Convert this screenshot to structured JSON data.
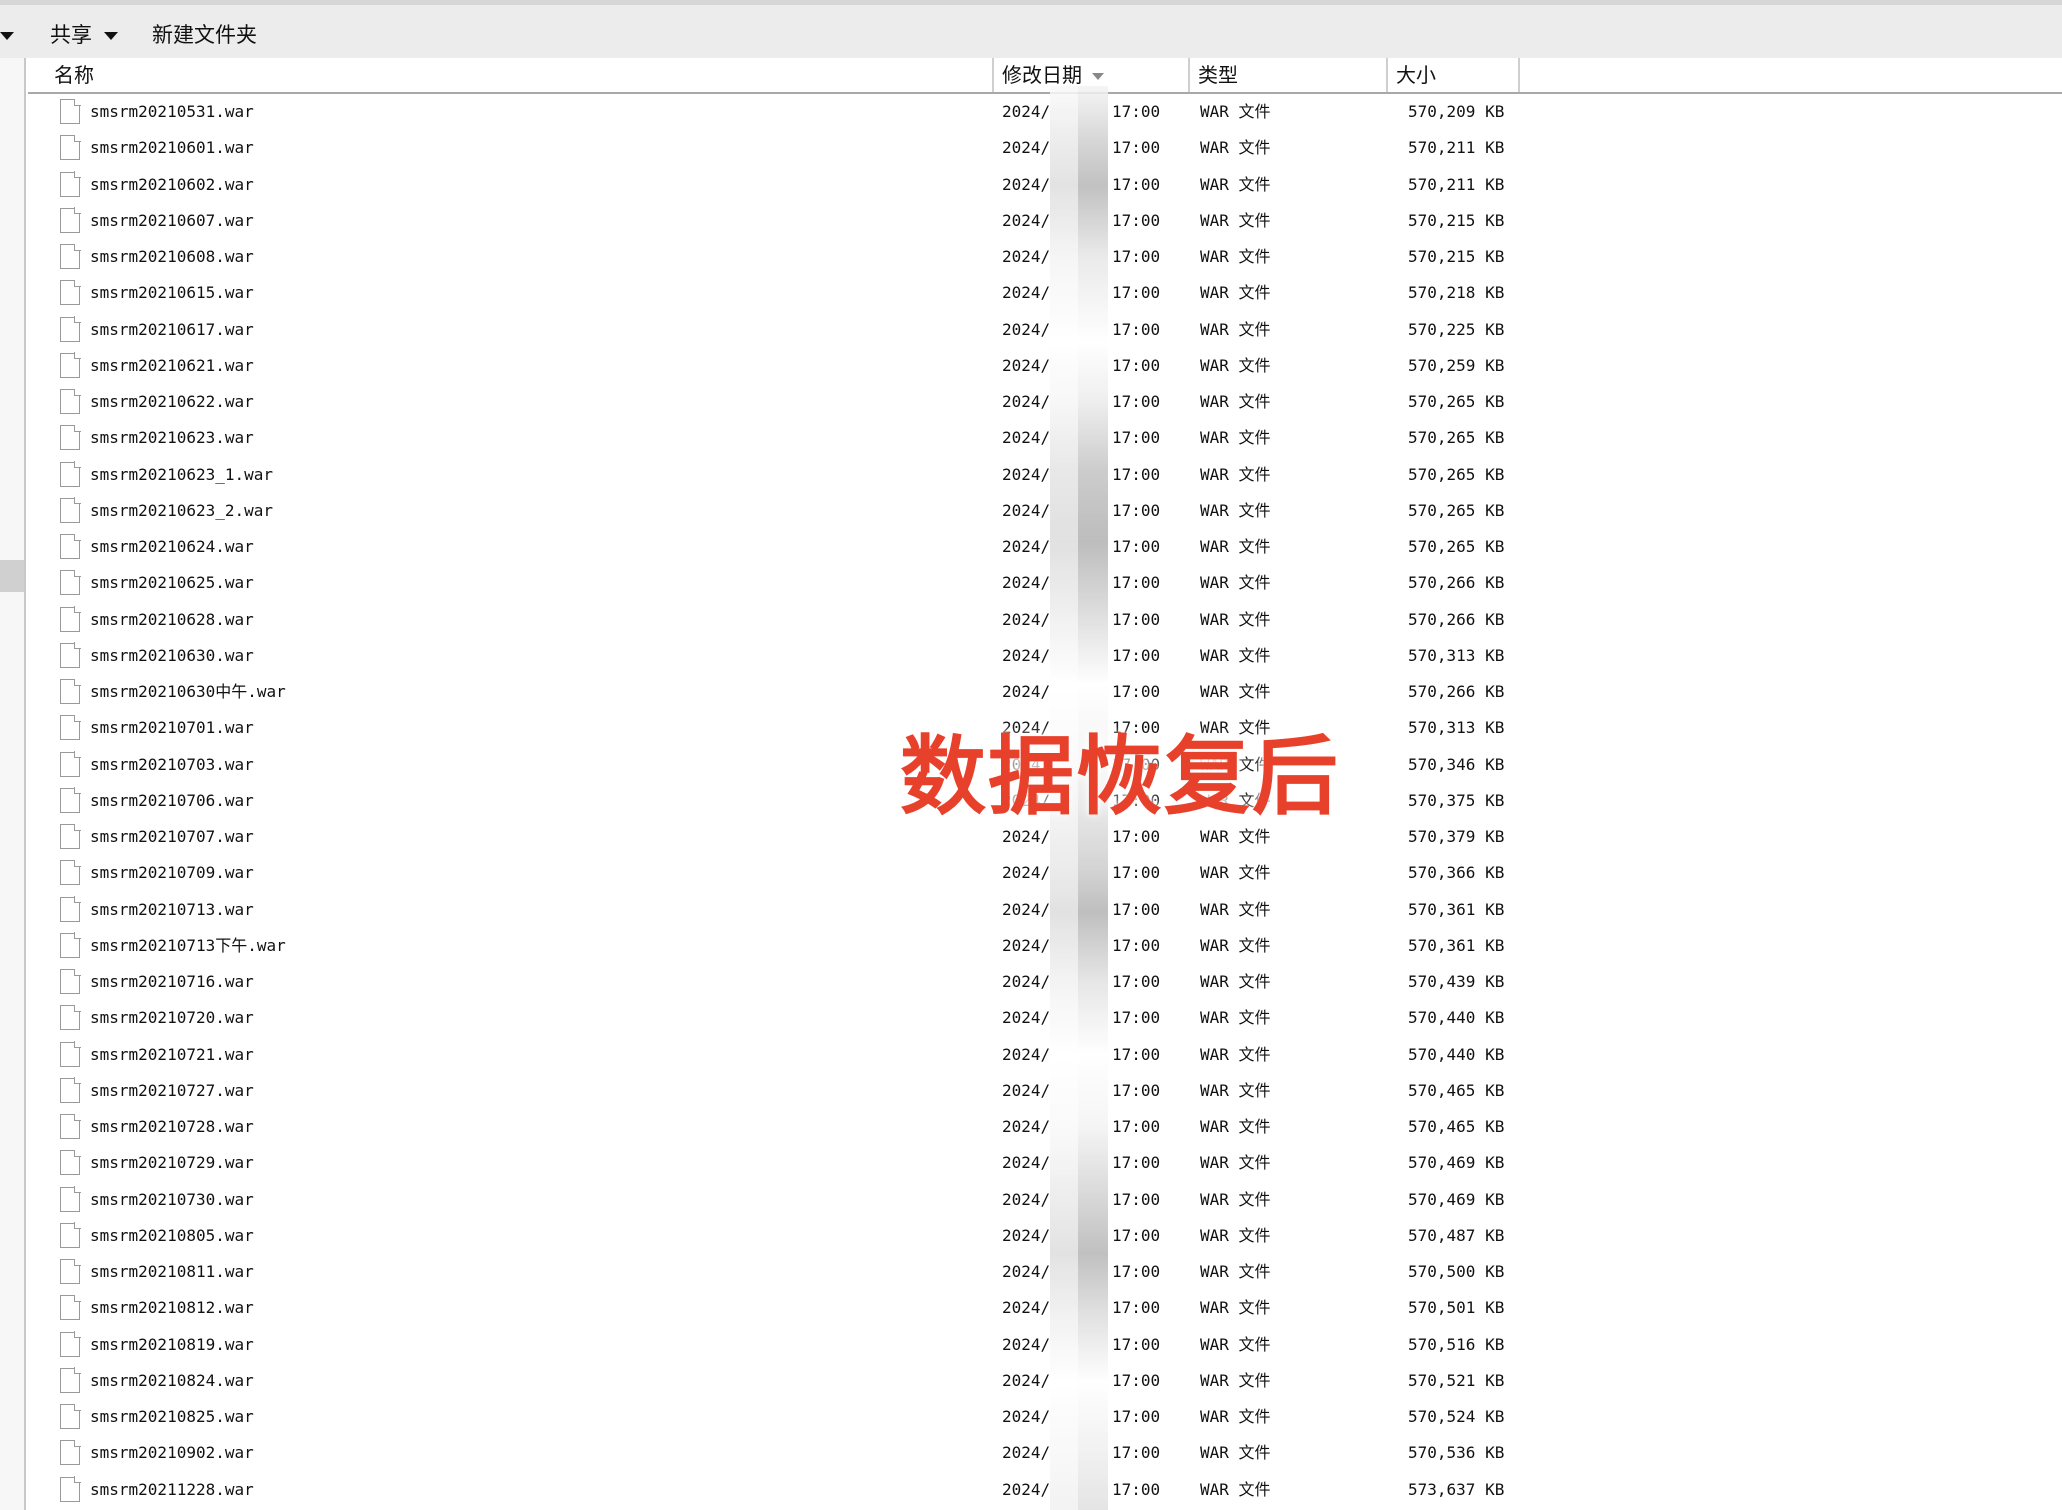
{
  "toolbar": {
    "share_label": "共享",
    "new_folder_label": "新建文件夹"
  },
  "columns": {
    "name": "名称",
    "date": "修改日期",
    "type": "类型",
    "size": "大小"
  },
  "files": [
    {
      "name": "smsrm20210531.war",
      "date": "2024/",
      "time": "17:00",
      "type": "WAR 文件",
      "size": "570,209 KB"
    },
    {
      "name": "smsrm20210601.war",
      "date": "2024/",
      "time": "17:00",
      "type": "WAR 文件",
      "size": "570,211 KB"
    },
    {
      "name": "smsrm20210602.war",
      "date": "2024/",
      "time": "17:00",
      "type": "WAR 文件",
      "size": "570,211 KB"
    },
    {
      "name": "smsrm20210607.war",
      "date": "2024/",
      "time": "17:00",
      "type": "WAR 文件",
      "size": "570,215 KB"
    },
    {
      "name": "smsrm20210608.war",
      "date": "2024/",
      "time": "17:00",
      "type": "WAR 文件",
      "size": "570,215 KB"
    },
    {
      "name": "smsrm20210615.war",
      "date": "2024/",
      "time": "17:00",
      "type": "WAR 文件",
      "size": "570,218 KB"
    },
    {
      "name": "smsrm20210617.war",
      "date": "2024/",
      "time": "17:00",
      "type": "WAR 文件",
      "size": "570,225 KB"
    },
    {
      "name": "smsrm20210621.war",
      "date": "2024/",
      "time": "17:00",
      "type": "WAR 文件",
      "size": "570,259 KB"
    },
    {
      "name": "smsrm20210622.war",
      "date": "2024/",
      "time": "17:00",
      "type": "WAR 文件",
      "size": "570,265 KB"
    },
    {
      "name": "smsrm20210623.war",
      "date": "2024/",
      "time": "17:00",
      "type": "WAR 文件",
      "size": "570,265 KB"
    },
    {
      "name": "smsrm20210623_1.war",
      "date": "2024/",
      "time": "17:00",
      "type": "WAR 文件",
      "size": "570,265 KB"
    },
    {
      "name": "smsrm20210623_2.war",
      "date": "2024/",
      "time": "17:00",
      "type": "WAR 文件",
      "size": "570,265 KB"
    },
    {
      "name": "smsrm20210624.war",
      "date": "2024/",
      "time": "17:00",
      "type": "WAR 文件",
      "size": "570,265 KB"
    },
    {
      "name": "smsrm20210625.war",
      "date": "2024/",
      "time": "17:00",
      "type": "WAR 文件",
      "size": "570,266 KB"
    },
    {
      "name": "smsrm20210628.war",
      "date": "2024/",
      "time": "17:00",
      "type": "WAR 文件",
      "size": "570,266 KB"
    },
    {
      "name": "smsrm20210630.war",
      "date": "2024/",
      "time": "17:00",
      "type": "WAR 文件",
      "size": "570,313 KB"
    },
    {
      "name": "smsrm20210630中午.war",
      "date": "2024/",
      "time": "17:00",
      "type": "WAR 文件",
      "size": "570,266 KB"
    },
    {
      "name": "smsrm20210701.war",
      "date": "2024/",
      "time": "17:00",
      "type": "WAR 文件",
      "size": "570,313 KB"
    },
    {
      "name": "smsrm20210703.war",
      "date": "2024/",
      "time": "17:00",
      "type": "WAR 文件",
      "size": "570,346 KB"
    },
    {
      "name": "smsrm20210706.war",
      "date": "2024/",
      "time": "17:00",
      "type": "WAR 文件",
      "size": "570,375 KB"
    },
    {
      "name": "smsrm20210707.war",
      "date": "2024/",
      "time": "17:00",
      "type": "WAR 文件",
      "size": "570,379 KB"
    },
    {
      "name": "smsrm20210709.war",
      "date": "2024/",
      "time": "17:00",
      "type": "WAR 文件",
      "size": "570,366 KB"
    },
    {
      "name": "smsrm20210713.war",
      "date": "2024/",
      "time": "17:00",
      "type": "WAR 文件",
      "size": "570,361 KB"
    },
    {
      "name": "smsrm20210713下午.war",
      "date": "2024/",
      "time": "17:00",
      "type": "WAR 文件",
      "size": "570,361 KB"
    },
    {
      "name": "smsrm20210716.war",
      "date": "2024/",
      "time": "17:00",
      "type": "WAR 文件",
      "size": "570,439 KB"
    },
    {
      "name": "smsrm20210720.war",
      "date": "2024/",
      "time": "17:00",
      "type": "WAR 文件",
      "size": "570,440 KB"
    },
    {
      "name": "smsrm20210721.war",
      "date": "2024/",
      "time": "17:00",
      "type": "WAR 文件",
      "size": "570,440 KB"
    },
    {
      "name": "smsrm20210727.war",
      "date": "2024/",
      "time": "17:00",
      "type": "WAR 文件",
      "size": "570,465 KB"
    },
    {
      "name": "smsrm20210728.war",
      "date": "2024/",
      "time": "17:00",
      "type": "WAR 文件",
      "size": "570,465 KB"
    },
    {
      "name": "smsrm20210729.war",
      "date": "2024/",
      "time": "17:00",
      "type": "WAR 文件",
      "size": "570,469 KB"
    },
    {
      "name": "smsrm20210730.war",
      "date": "2024/",
      "time": "17:00",
      "type": "WAR 文件",
      "size": "570,469 KB"
    },
    {
      "name": "smsrm20210805.war",
      "date": "2024/",
      "time": "17:00",
      "type": "WAR 文件",
      "size": "570,487 KB"
    },
    {
      "name": "smsrm20210811.war",
      "date": "2024/",
      "time": "17:00",
      "type": "WAR 文件",
      "size": "570,500 KB"
    },
    {
      "name": "smsrm20210812.war",
      "date": "2024/",
      "time": "17:00",
      "type": "WAR 文件",
      "size": "570,501 KB"
    },
    {
      "name": "smsrm20210819.war",
      "date": "2024/",
      "time": "17:00",
      "type": "WAR 文件",
      "size": "570,516 KB"
    },
    {
      "name": "smsrm20210824.war",
      "date": "2024/",
      "time": "17:00",
      "type": "WAR 文件",
      "size": "570,521 KB"
    },
    {
      "name": "smsrm20210825.war",
      "date": "2024/",
      "time": "17:00",
      "type": "WAR 文件",
      "size": "570,524 KB"
    },
    {
      "name": "smsrm20210902.war",
      "date": "2024/",
      "time": "17:00",
      "type": "WAR 文件",
      "size": "570,536 KB"
    },
    {
      "name": "smsrm20211228.war",
      "date": "2024/",
      "time": "17:00",
      "type": "WAR 文件",
      "size": "573,637 KB"
    }
  ],
  "watermark": {
    "text": "数据恢复后",
    "color": "#e8412b"
  }
}
